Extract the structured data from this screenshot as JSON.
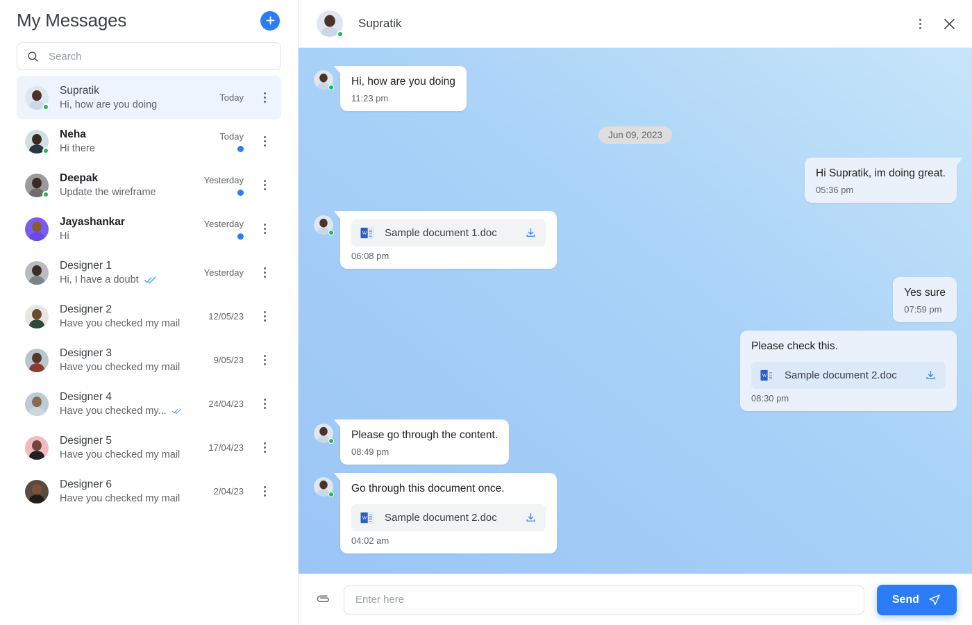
{
  "sidebar": {
    "title": "My Messages",
    "new_chat_icon": "plus-icon",
    "search": {
      "placeholder": "Search",
      "value": "",
      "icon": "search-icon"
    },
    "conversations": [
      {
        "name": "Supratik",
        "preview": "Hi, how are you doing",
        "time": "Today",
        "active": true,
        "unread": false,
        "bold": false,
        "online": true,
        "read_receipt": false,
        "avatar": "man-glasses-lightblue"
      },
      {
        "name": "Neha",
        "preview": "Hi there",
        "time": "Today",
        "active": false,
        "unread": true,
        "bold": true,
        "online": true,
        "read_receipt": false,
        "avatar": "woman-dark-teal"
      },
      {
        "name": "Deepak",
        "preview": "Update the wireframe",
        "time": "Yesterday",
        "active": false,
        "unread": true,
        "bold": true,
        "online": true,
        "read_receipt": false,
        "avatar": "man-gray"
      },
      {
        "name": "Jayashankar",
        "preview": "Hi",
        "time": "Yesterday",
        "active": false,
        "unread": true,
        "bold": true,
        "online": false,
        "read_receipt": false,
        "avatar": "avatar-purple-illustration"
      },
      {
        "name": "Designer 1",
        "preview": "Hi, I have a doubt",
        "time": "Yesterday",
        "active": false,
        "unread": false,
        "bold": false,
        "online": false,
        "read_receipt": true,
        "avatar": "person-bw"
      },
      {
        "name": "Designer 2",
        "preview": "Have you checked my mail",
        "time": "12/05/23",
        "active": false,
        "unread": false,
        "bold": false,
        "online": false,
        "read_receipt": false,
        "avatar": "man-bald-green"
      },
      {
        "name": "Designer 3",
        "preview": "Have you checked my mail",
        "time": "9/05/23",
        "active": false,
        "unread": false,
        "bold": false,
        "online": false,
        "read_receipt": false,
        "avatar": "person-red-hair"
      },
      {
        "name": "Designer 4",
        "preview": "Have you checked my...",
        "time": "24/04/23",
        "active": false,
        "unread": false,
        "bold": false,
        "online": false,
        "read_receipt": true,
        "avatar": "woman-gray-hair"
      },
      {
        "name": "Designer 5",
        "preview": "Have you checked my mail",
        "time": "17/04/23",
        "active": false,
        "unread": false,
        "bold": false,
        "online": false,
        "read_receipt": false,
        "avatar": "man-beard-pink"
      },
      {
        "name": "Designer 6",
        "preview": "Have you checked my mail",
        "time": "2/04/23",
        "active": false,
        "unread": false,
        "bold": false,
        "online": false,
        "read_receipt": false,
        "avatar": "woman-dark-hair"
      }
    ],
    "kebab_icon": "more-vertical-icon",
    "unread_badge_color": "#2b7cf6",
    "online_dot_color": "#1db954",
    "read_receipt_color": "#4aa3f0",
    "active_row_color": "#eef4fe"
  },
  "chat": {
    "peer_name": "Supratik",
    "peer_online": true,
    "menu_icon": "more-vertical-icon",
    "close_icon": "close-icon",
    "date_divider": "Jun 09, 2023",
    "background_gradient": [
      "#c6e5f9",
      "#9bc5f5"
    ],
    "messages": [
      {
        "id": "m1",
        "dir": "in",
        "text": "Hi, how are you doing",
        "time": "11:23 pm",
        "avatar": true,
        "tail": true,
        "doc": null
      },
      {
        "id": "m2",
        "dir": "out",
        "text": "Hi Supratik, im doing great.",
        "time": "05:36 pm",
        "avatar": false,
        "tail": true,
        "doc": null
      },
      {
        "id": "m3",
        "dir": "in",
        "text": "",
        "time": "06:08 pm",
        "avatar": true,
        "tail": true,
        "doc": "Sample document 1.doc"
      },
      {
        "id": "m4",
        "dir": "out",
        "text": "Yes sure",
        "time": "07:59 pm",
        "avatar": false,
        "tail": false,
        "doc": null
      },
      {
        "id": "m5",
        "dir": "out",
        "text": "Please check this.",
        "time": "08:30 pm",
        "avatar": false,
        "tail": false,
        "doc": "Sample document 2.doc"
      },
      {
        "id": "m6",
        "dir": "in",
        "text": "Please go through the content.",
        "time": "08:49 pm",
        "avatar": true,
        "tail": true,
        "doc": null
      },
      {
        "id": "m7",
        "dir": "in",
        "text": "Go through this document once.",
        "time": "04:02 am",
        "avatar": true,
        "tail": true,
        "doc": "Sample document 2.doc"
      }
    ],
    "doc_icon": "word-document-icon",
    "download_icon": "download-icon"
  },
  "composer": {
    "attach_icon": "paperclip-icon",
    "placeholder": "Enter here",
    "value": "",
    "send_label": "Send",
    "send_icon": "send-plane-icon",
    "send_color": "#2b7cf6"
  }
}
